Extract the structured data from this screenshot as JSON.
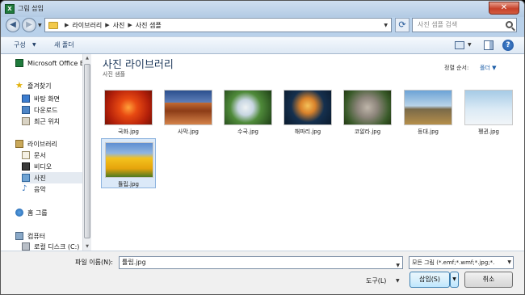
{
  "window": {
    "title": "그림 삽입",
    "close_glyph": "✕",
    "app_icon_glyph": "X"
  },
  "navbar": {
    "back_glyph": "◀",
    "forward_glyph": "▶",
    "breadcrumbs": [
      "라이브러리",
      "사진",
      "사진 샘플"
    ],
    "search_placeholder": "사진 샘플 검색"
  },
  "toolbar": {
    "organize_label": "구성",
    "new_folder_label": "새 폴더",
    "help_glyph": "?"
  },
  "navpane": {
    "items": [
      {
        "label": "Microsoft Office E:",
        "icon": "office-icon"
      },
      {
        "label": "즐겨찾기",
        "icon": "star-icon"
      },
      {
        "label": "바탕 화면",
        "icon": "desktop-icon"
      },
      {
        "label": "다운로드",
        "icon": "download-icon"
      },
      {
        "label": "최근 위치",
        "icon": "recent-places-icon"
      },
      {
        "label": "라이브러리",
        "icon": "library-icon"
      },
      {
        "label": "문서",
        "icon": "documents-icon"
      },
      {
        "label": "비디오",
        "icon": "video-icon"
      },
      {
        "label": "사진",
        "icon": "pictures-icon"
      },
      {
        "label": "음악",
        "icon": "music-icon"
      },
      {
        "label": "홈 그룹",
        "icon": "homegroup-icon"
      },
      {
        "label": "컴퓨터",
        "icon": "computer-icon"
      },
      {
        "label": "로컬 디스크 (C:)",
        "icon": "disk-icon"
      }
    ],
    "selected": "사진"
  },
  "content": {
    "library_title": "사진 라이브러리",
    "library_subtitle": "사진 샘플",
    "arrange_label": "정렬 순서:",
    "arrange_value": "폴더 ▼",
    "files": [
      {
        "name": "국화.jpg"
      },
      {
        "name": "사막.jpg"
      },
      {
        "name": "수국.jpg"
      },
      {
        "name": "해파리.jpg"
      },
      {
        "name": "코알라.jpg"
      },
      {
        "name": "등대.jpg"
      },
      {
        "name": "펭귄.jpg"
      },
      {
        "name": "튤립.jpg"
      }
    ],
    "selected_file": "튤립.jpg"
  },
  "bottom": {
    "filename_label": "파일 이름(N):",
    "filename_value": "튤립.jpg",
    "filetype_value": "모든 그림 (*.emf;*.wmf;*.jpg;*.",
    "tools_label": "도구(L)",
    "insert_label": "삽입(S)",
    "cancel_label": "취소"
  }
}
